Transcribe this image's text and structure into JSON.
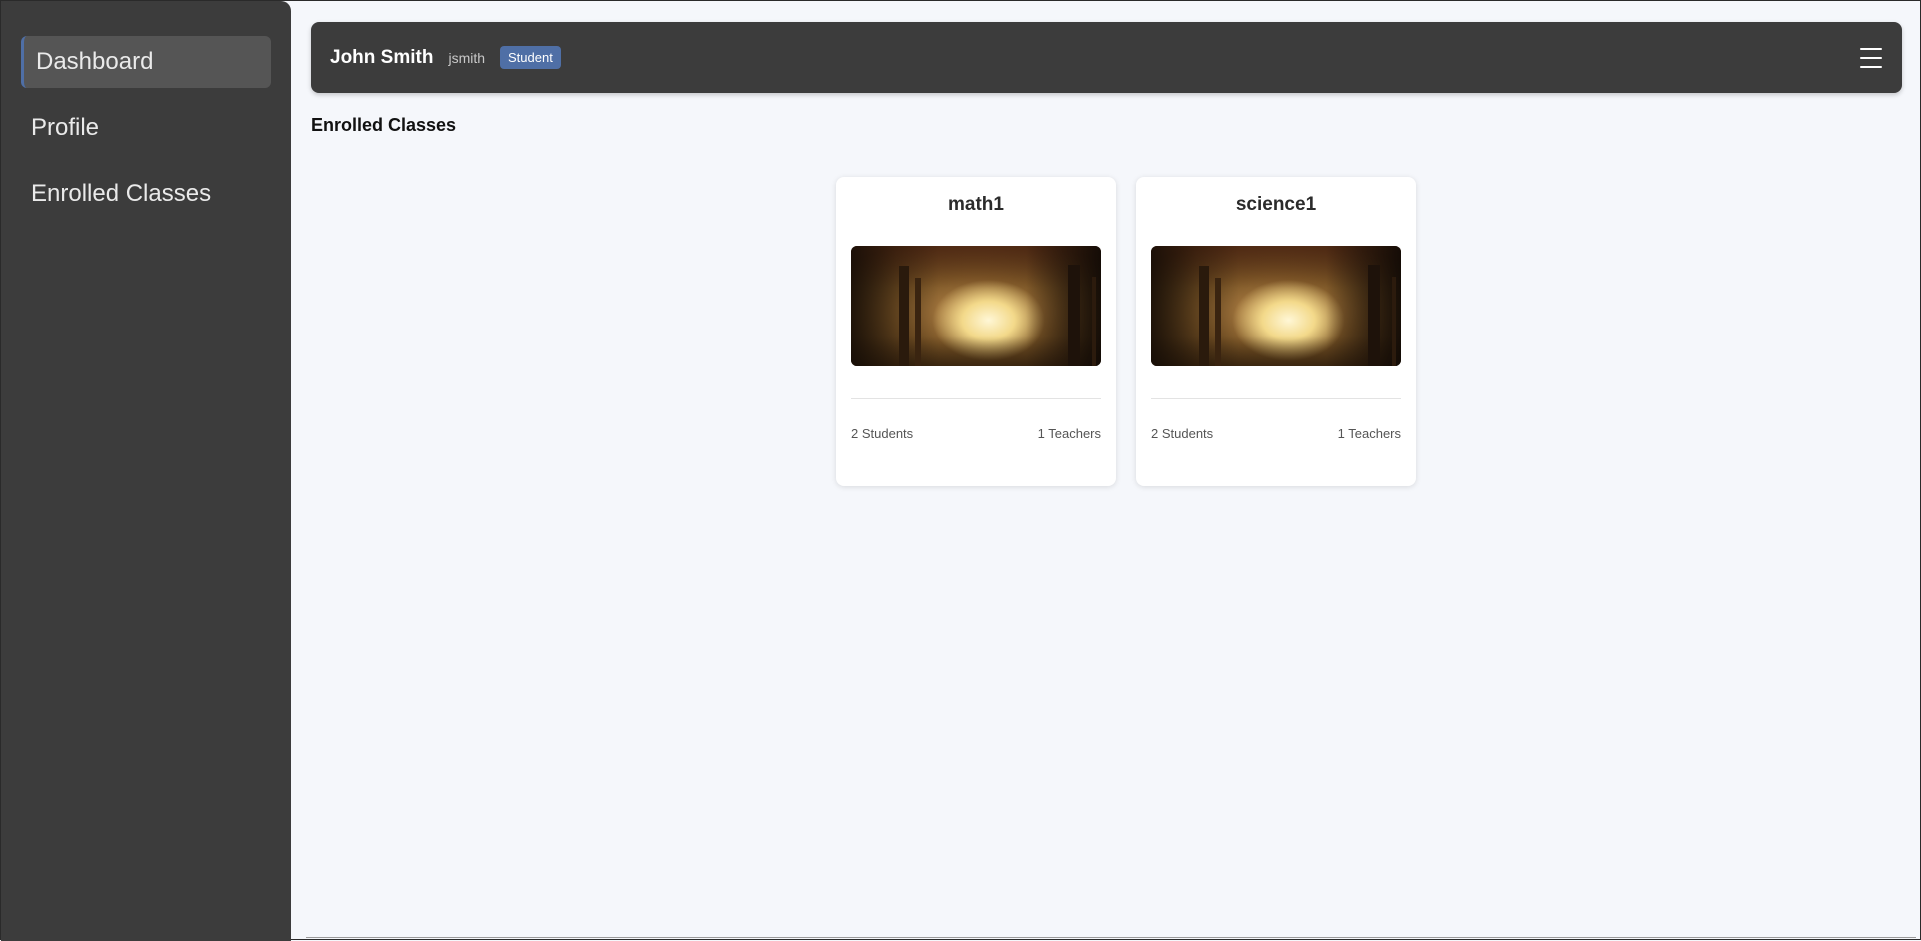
{
  "sidebar": {
    "items": [
      {
        "label": "Dashboard",
        "active": true
      },
      {
        "label": "Profile",
        "active": false
      },
      {
        "label": "Enrolled Classes",
        "active": false
      }
    ]
  },
  "header": {
    "name": "John Smith",
    "username": "jsmith",
    "role": "Student",
    "menu_icon": "hamburger-menu-icon"
  },
  "main": {
    "section_title": "Enrolled Classes",
    "classes": [
      {
        "title": "math1",
        "students": "2 Students",
        "teachers": "1 Teachers"
      },
      {
        "title": "science1",
        "students": "2 Students",
        "teachers": "1 Teachers"
      }
    ]
  },
  "colors": {
    "sidebar_bg": "#3c3c3c",
    "header_bg": "#3c3c3c",
    "accent": "#4f6fa6",
    "page_bg": "#f5f7fb"
  }
}
